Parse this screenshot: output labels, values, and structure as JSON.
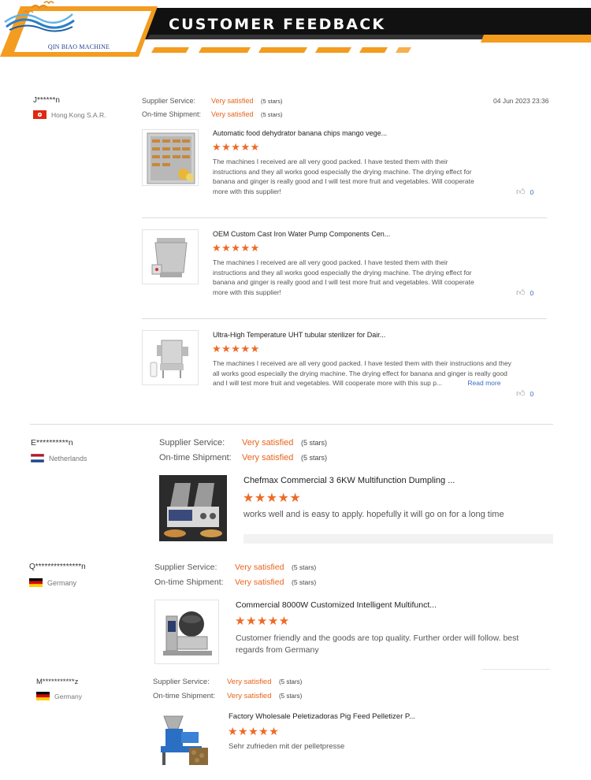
{
  "banner": {
    "title": "CUSTOMER FEEDBACK",
    "logo_text": "QIN BIAO MACHINE",
    "colors": {
      "orange": "#f39c1f",
      "black": "#111111"
    }
  },
  "labels": {
    "supplier_service": "Supplier Service:",
    "on_time_shipment": "On-time Shipment:",
    "very_satisfied": "Very satisfied",
    "five_stars": "(5 stars)",
    "read_more": "Read more",
    "stars_glyphs": "★★★★★"
  },
  "reviews": [
    {
      "reviewer": "J******n",
      "country": "Hong Kong S.A.R.",
      "date": "04 Jun 2023 23:36",
      "products": [
        {
          "title": "Automatic food dehydrator banana chips mango vege...",
          "text": "The machines I received are all very good packed. I have tested them with their instructions and they all works good especially the drying machine. The drying effect for banana and ginger is really good and I will test more fruit and vegetables. Will cooperate more with this supplier!",
          "likes": "0"
        },
        {
          "title": "OEM Custom Cast Iron Water Pump Components Cen...",
          "text": "The machines I received are all very good packed. I have tested them with their instructions and they all works good especially the drying machine. The drying effect for banana and ginger is really good and I will test more fruit and vegetables. Will cooperate more with this supplier!",
          "likes": "0"
        },
        {
          "title": "Ultra-High Temperature UHT tubular sterilizer for Dair...",
          "text": "The machines I received are all very good packed. I have tested them with their instructions and they all works good especially the drying machine. The drying effect for banana and ginger is really good and I will test more fruit and vegetables. Will cooperate more with this sup p...",
          "likes": "0"
        }
      ]
    },
    {
      "reviewer": "E**********n",
      "country": "Netherlands",
      "product": {
        "title": "Chefmax Commercial 3 6KW Multifunction Dumpling ...",
        "text": "works well and is easy to apply. hopefully it will go on for a long time"
      }
    },
    {
      "reviewer": "Q***************n",
      "country": "Germany",
      "product": {
        "title": "Commercial 8000W Customized Intelligent Multifunct...",
        "text": "Customer friendly and the goods are top quality.  Further order will follow. best regards from Germany"
      }
    },
    {
      "reviewer": "M***********z",
      "country": "Germany",
      "product": {
        "title": "Factory Wholesale Peletizadoras Pig Feed Pelletizer P...",
        "text": "Sehr zufrieden mit der pelletpresse"
      }
    }
  ]
}
